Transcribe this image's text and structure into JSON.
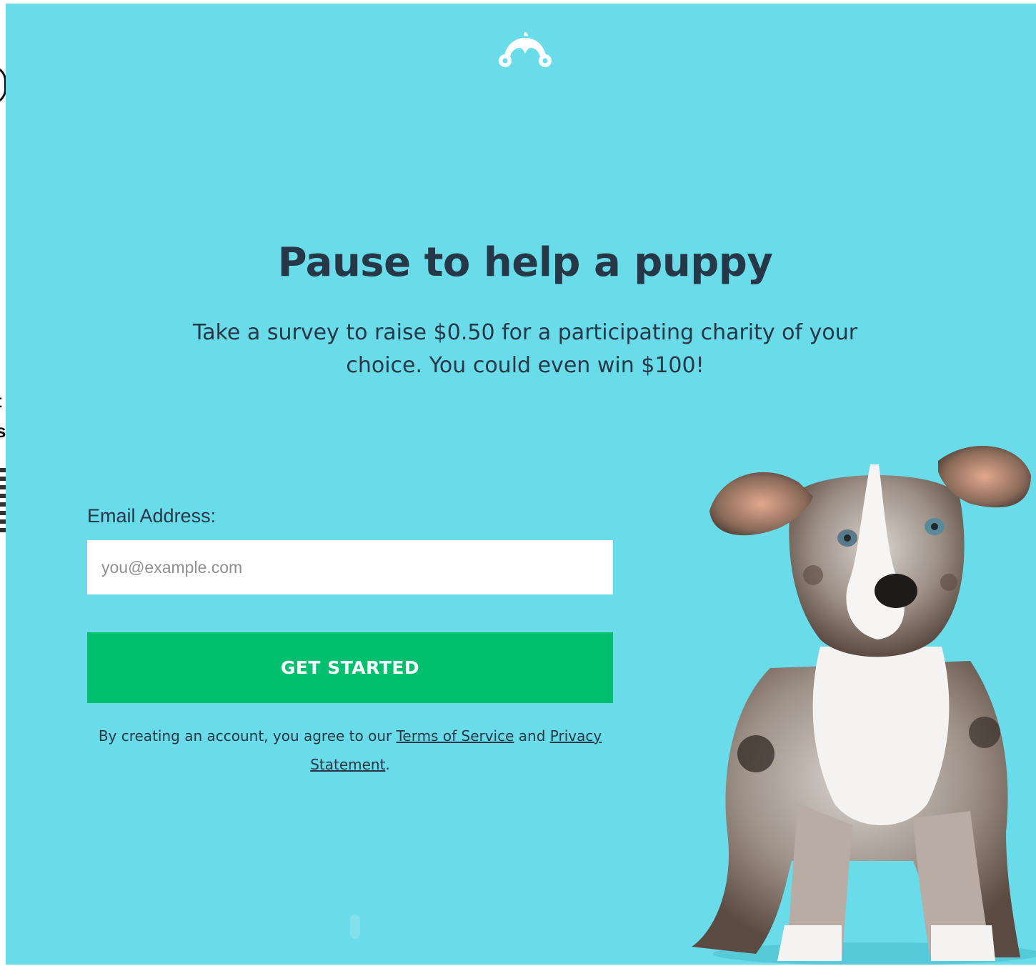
{
  "brand": {
    "logo_icon": "surveymonkey-logo-icon",
    "background_color": "#6adbe8",
    "accent_color": "#00bf6f",
    "text_color": "#263847"
  },
  "hero": {
    "headline": "Pause to help a puppy",
    "subhead": "Take a survey to raise $0.50 for a participating charity of your choice. You could even win $100!"
  },
  "form": {
    "email_label": "Email Address:",
    "email_placeholder": "you@example.com",
    "email_value": "",
    "submit_label": "GET STARTED"
  },
  "legal": {
    "prefix": "By creating an account, you agree to our ",
    "terms_link": "Terms of Service",
    "joiner": " and ",
    "privacy_link": "Privacy Statement",
    "suffix": "."
  },
  "edge_fragments": {
    "line1": "t",
    "line2": "s"
  }
}
